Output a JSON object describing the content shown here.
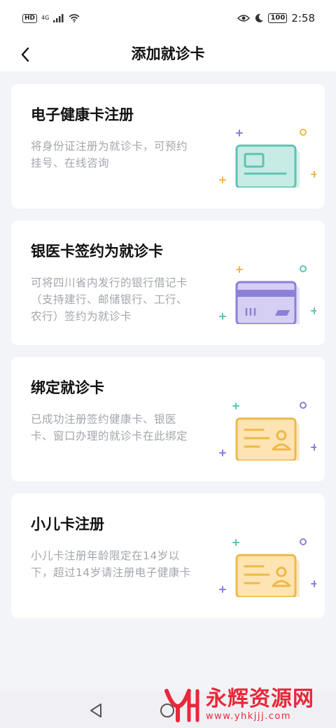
{
  "status_bar": {
    "hd": "HD",
    "network": "4G",
    "battery": "100",
    "time": "2:58"
  },
  "nav": {
    "title": "添加就诊卡"
  },
  "cards": [
    {
      "title": "电子健康卡注册",
      "desc": "将身份证注册为就诊卡，可预约挂号、在线咨询",
      "icon": "id-card-icon",
      "color": "#5fc3b3"
    },
    {
      "title": "银医卡签约为就诊卡",
      "desc": "可将四川省内发行的银行借记卡（支持建行、邮储银行、工行、农行）签约为就诊卡",
      "icon": "bank-card-icon",
      "color": "#8b80d8"
    },
    {
      "title": "绑定就诊卡",
      "desc": "已成功注册签约健康卡、银医卡、窗口办理的就诊卡在此绑定",
      "icon": "profile-card-icon",
      "color": "#efb84a"
    },
    {
      "title": "小儿卡注册",
      "desc": "小儿卡注册年龄限定在14岁以下，超过14岁请注册电子健康卡",
      "icon": "profile-card-icon",
      "color": "#efb84a"
    }
  ],
  "watermark": {
    "text": "永辉资源网",
    "url": "www.yhkjjj.com"
  }
}
